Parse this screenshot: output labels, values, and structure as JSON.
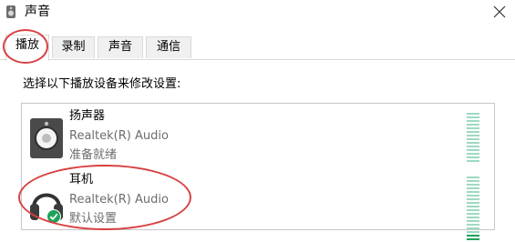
{
  "window": {
    "title": "声音",
    "app_icon": "speaker-icon",
    "close_icon": "close-icon"
  },
  "tabs": [
    {
      "label": "播放",
      "selected": true
    },
    {
      "label": "录制",
      "selected": false
    },
    {
      "label": "声音",
      "selected": false
    },
    {
      "label": "通信",
      "selected": false
    }
  ],
  "instruction": "选择以下播放设备来修改设置:",
  "devices": [
    {
      "name": "扬声器",
      "driver": "Realtek(R) Audio",
      "status": "准备就绪",
      "icon": "speaker-device-icon",
      "level": 0
    },
    {
      "name": "耳机",
      "driver": "Realtek(R) Audio",
      "status": "默认设置",
      "icon": "headphones-icon",
      "badge": "default-check-icon",
      "level": 0.1
    }
  ],
  "colors": {
    "highlight_ring": "#d94141",
    "meter_segment": "#9ed9c1",
    "meter_active": "#1fa35a",
    "default_badge": "#1fa35a"
  }
}
